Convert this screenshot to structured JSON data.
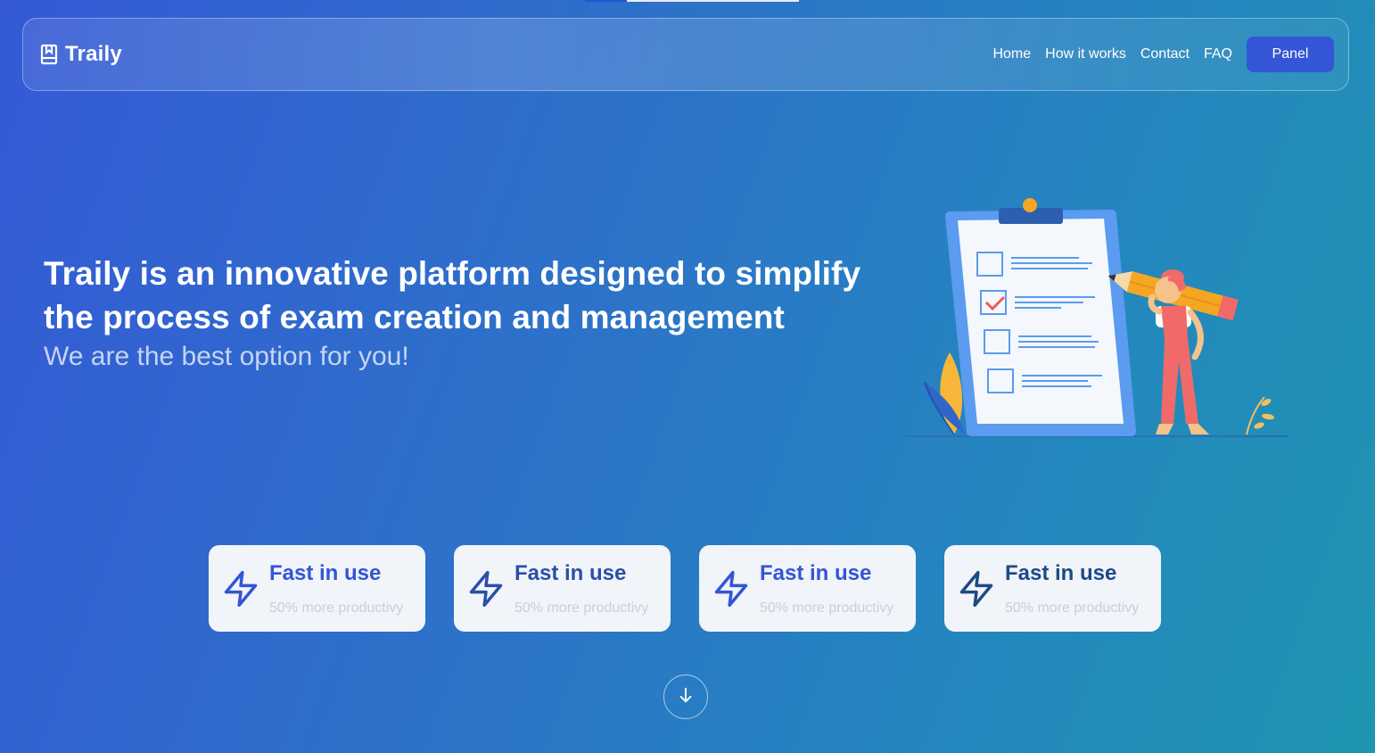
{
  "brand": {
    "name": "Traily",
    "icon": "book-icon"
  },
  "nav": {
    "items": [
      {
        "label": "Home"
      },
      {
        "label": "How it works"
      },
      {
        "label": "Contact"
      },
      {
        "label": "FAQ"
      }
    ],
    "panel_label": "Panel"
  },
  "hero": {
    "title": "Traily is an innovative platform designed to simplify the process of exam creation and management",
    "subtitle": "We are the best option for you!"
  },
  "features": [
    {
      "title": "Fast in use",
      "subtitle": "50% more productivy",
      "icon": "lightning-icon",
      "color": "#3355d6"
    },
    {
      "title": "Fast in use",
      "subtitle": "50% more productivy",
      "icon": "lightning-icon",
      "color": "#2b4fa8"
    },
    {
      "title": "Fast in use",
      "subtitle": "50% more productivy",
      "icon": "lightning-icon",
      "color": "#3355d6"
    },
    {
      "title": "Fast in use",
      "subtitle": "50% more productivy",
      "icon": "lightning-icon",
      "color": "#1d4a86"
    }
  ],
  "scroll_icon": "arrow-down-icon",
  "colors": {
    "accent": "#3355d6",
    "card_bg": "#f1f4f9"
  }
}
